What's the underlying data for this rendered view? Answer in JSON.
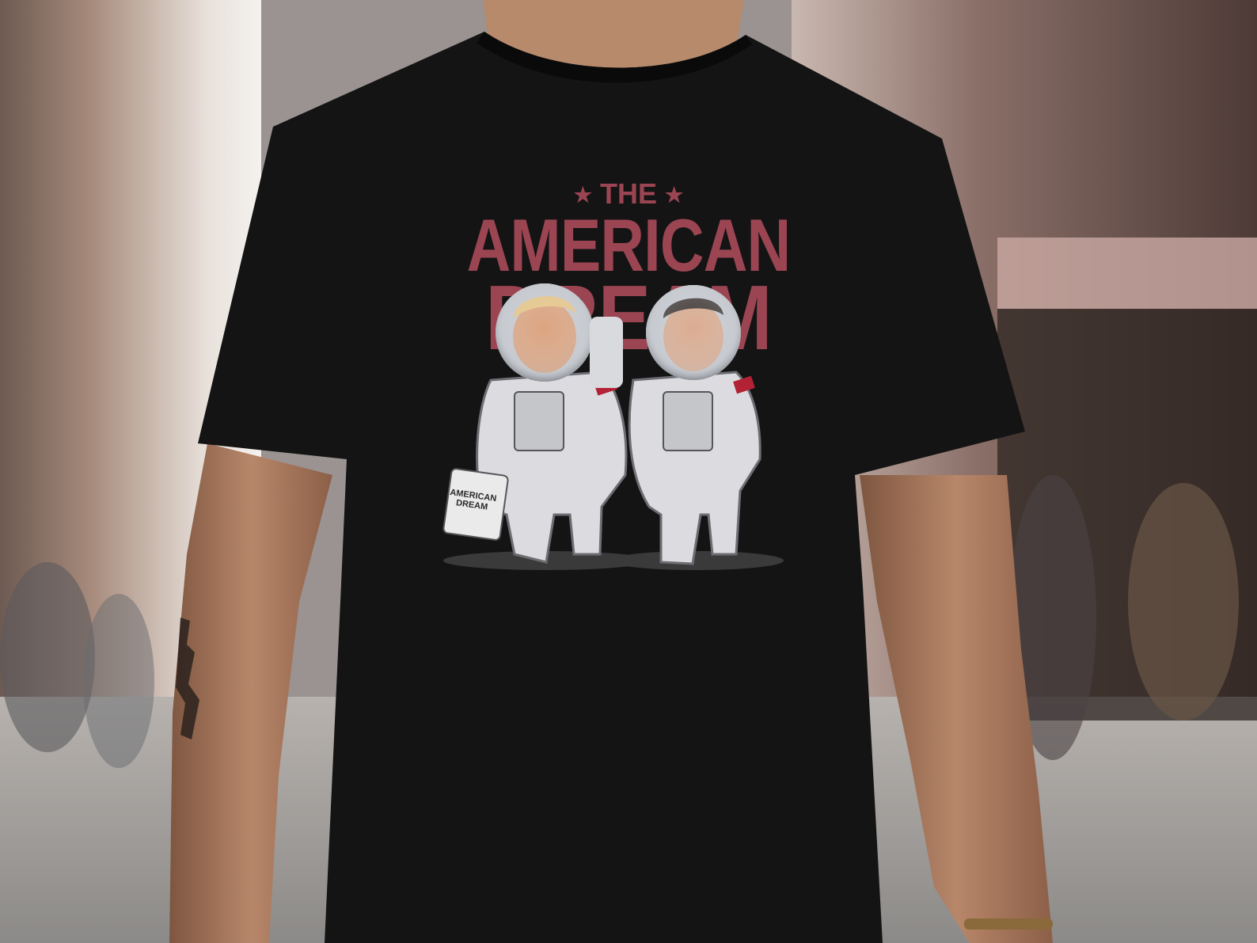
{
  "image": {
    "description_free": true,
    "colors": {
      "shirt": "#141414",
      "print_text": "#9b4553",
      "skin": "#b98a6a",
      "suit": "#dcdce0",
      "background_street": "#8b8e92"
    }
  },
  "shirt_print": {
    "line1": "THE",
    "line2": "AMERICAN",
    "line3": "DREAM",
    "star_left": "★",
    "star_right": "★",
    "case_text_line1": "AMERICAN",
    "case_text_line2": "DREAM"
  }
}
